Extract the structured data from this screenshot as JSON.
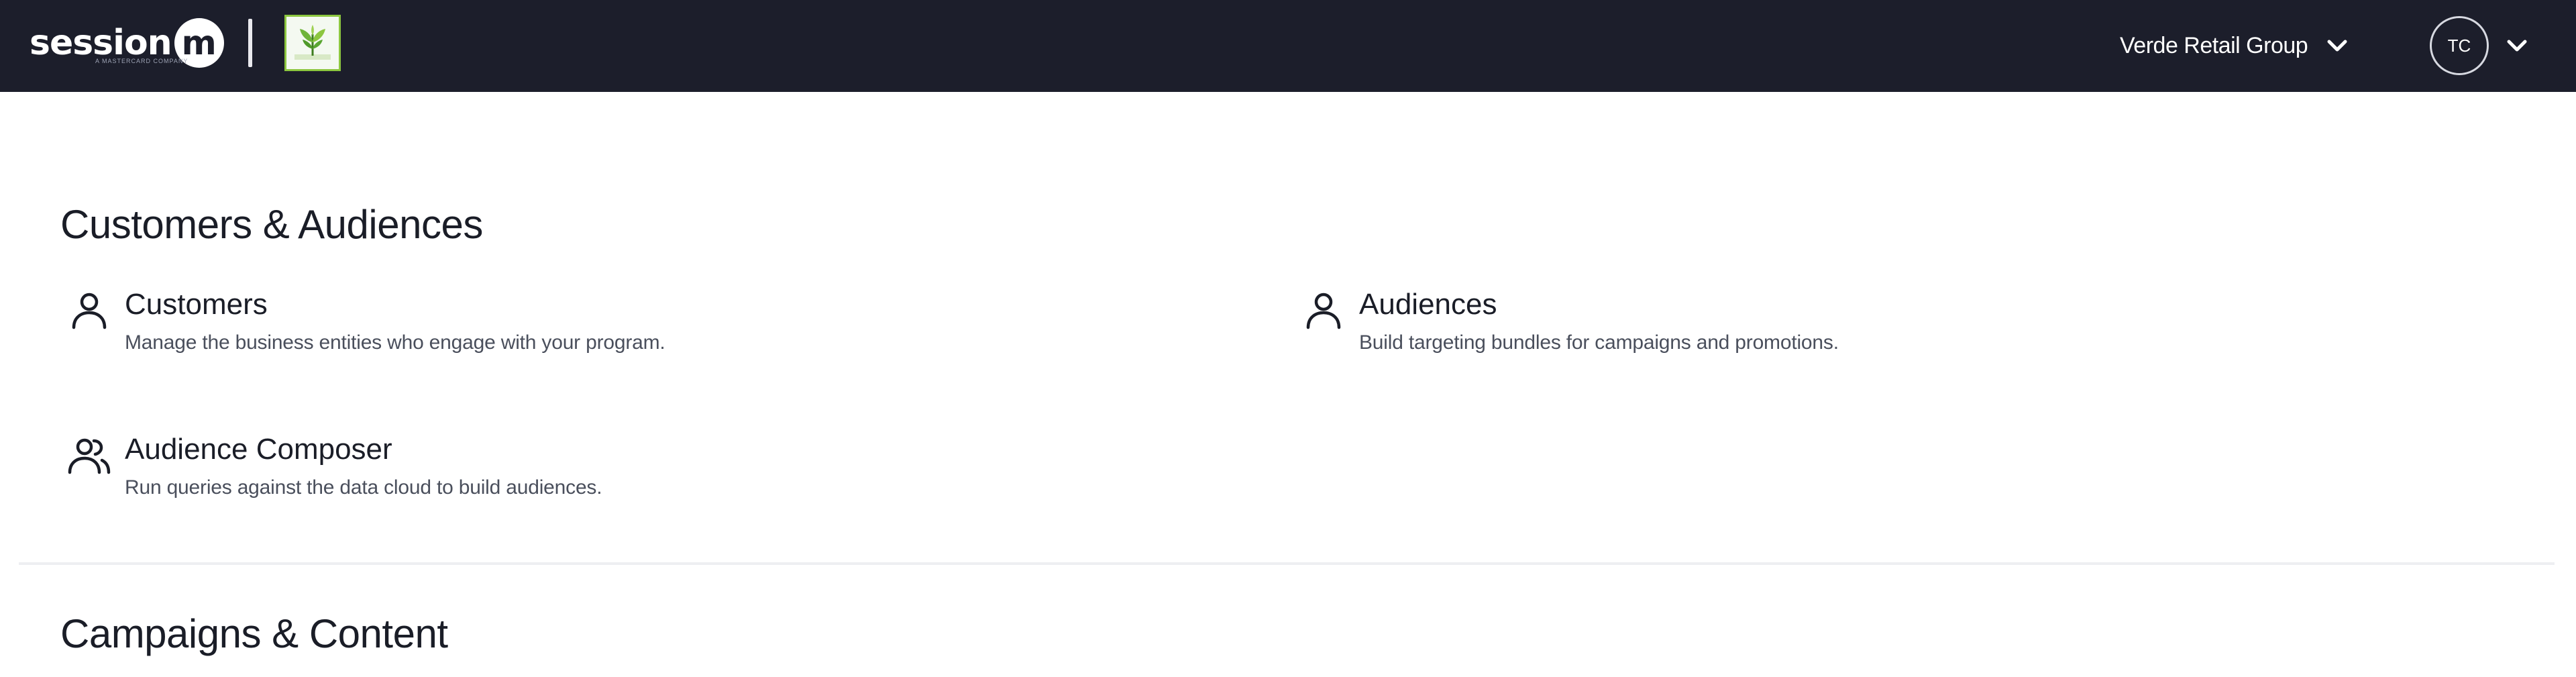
{
  "header": {
    "brand_name": "session",
    "brand_mark": "m",
    "brand_tagline": "A MASTERCARD COMPANY",
    "org_logo": "leaf-logo-icon",
    "org_name": "Verde Retail Group",
    "user_initials": "TC"
  },
  "sections": [
    {
      "title": "Customers & Audiences",
      "items": [
        {
          "label": "Customers",
          "description": "Manage the business entities who engage with your program.",
          "icon": "person-icon"
        },
        {
          "label": "Audiences",
          "description": "Build targeting bundles for campaigns and promotions.",
          "icon": "person-icon"
        },
        {
          "label": "Audience Composer",
          "description": "Run queries against the data cloud to build audiences.",
          "icon": "people-icon"
        }
      ]
    },
    {
      "title": "Campaigns & Content",
      "items": []
    }
  ],
  "colors": {
    "topbar_bg": "#1c1e2b",
    "page_bg": "#ffffff",
    "text_primary": "#1a1d27",
    "text_secondary": "#4a4f5c",
    "org_logo_green": "#8cc63f"
  }
}
